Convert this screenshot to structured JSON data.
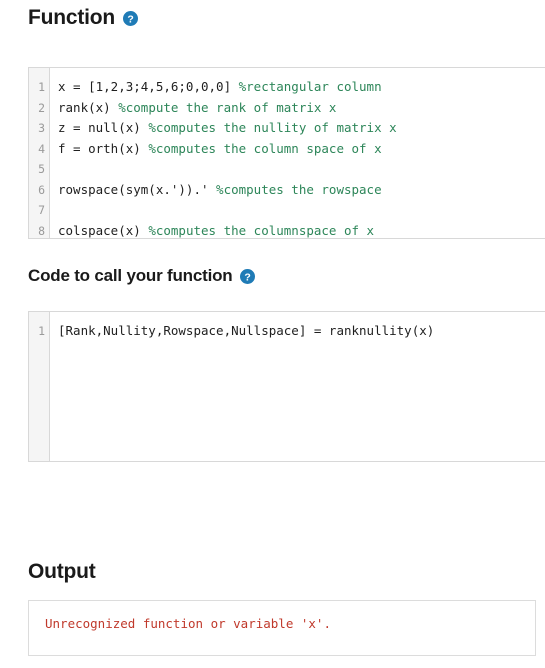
{
  "sections": {
    "function": {
      "heading": "Function",
      "help_icon": "help-circle-icon",
      "editor": {
        "line_numbers": [
          "1",
          "2",
          "3",
          "4",
          "5",
          "6",
          "7",
          "8"
        ],
        "lines": [
          {
            "code": "x = [1,2,3;4,5,6;0,0,0] ",
            "comment": "%rectangular column"
          },
          {
            "code": "rank(x) ",
            "comment": "%compute the rank of matrix x"
          },
          {
            "code": "z = null(x) ",
            "comment": "%computes the nullity of matrix x"
          },
          {
            "code": "f = orth(x) ",
            "comment": "%computes the column space of x"
          },
          {
            "code": "",
            "comment": ""
          },
          {
            "code": "rowspace(sym(x.')).' ",
            "comment": "%computes the rowspace"
          },
          {
            "code": "",
            "comment": ""
          },
          {
            "code": "colspace(x) ",
            "comment": "%computes the columnspace of x"
          }
        ]
      }
    },
    "call_code": {
      "heading": "Code to call your function",
      "help_icon": "help-circle-icon",
      "editor": {
        "line_numbers": [
          "1"
        ],
        "lines": [
          {
            "code": "[Rank,Nullity,Rowspace,Nullspace] = ranknullity(x)",
            "comment": ""
          }
        ]
      }
    },
    "output": {
      "heading": "Output",
      "message": "Unrecognized function or variable 'x'."
    }
  },
  "colors": {
    "help_icon_blue": "#1f7bb6",
    "comment_green": "#2d8659",
    "error_red": "#c0392b",
    "gutter_gray": "#f5f5f5",
    "border_gray": "#d8d8d8",
    "heading_text": "#1a1a1a"
  }
}
